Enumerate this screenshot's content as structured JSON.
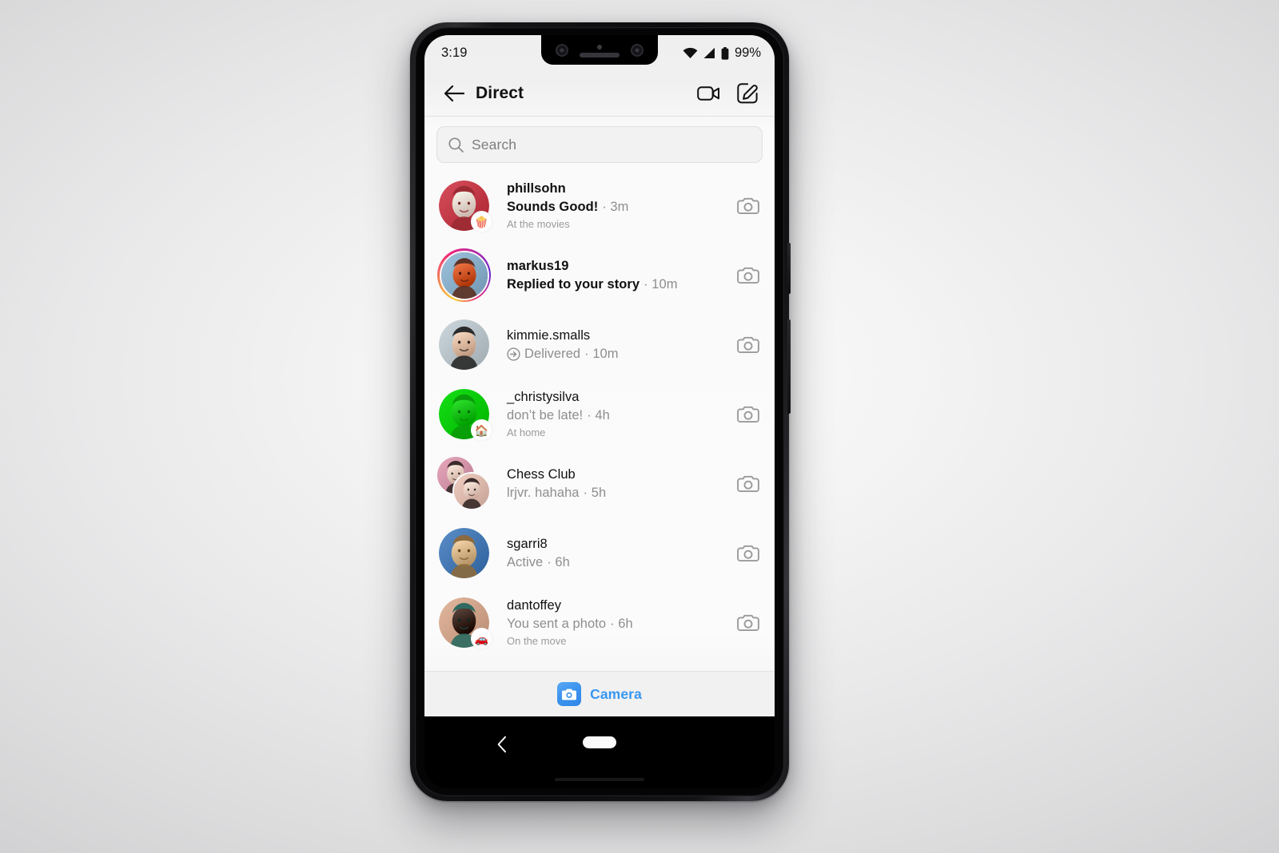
{
  "status_bar": {
    "time": "3:19",
    "battery_percent": "99%",
    "wifi_icon": "wifi-icon",
    "signal_icon": "cellular-signal-icon",
    "battery_icon": "battery-full-icon"
  },
  "header": {
    "back_icon": "back-arrow-icon",
    "title": "Direct",
    "video_call_icon": "video-camera-icon",
    "compose_icon": "compose-edit-icon"
  },
  "search": {
    "placeholder": "Search",
    "value": "",
    "icon": "search-icon"
  },
  "threads": [
    {
      "name": "phillsohn",
      "preview": "Sounds Good!",
      "timestamp": "3m",
      "unread": true,
      "status_note": "At the movies",
      "badge": "popcorn-badge",
      "badge_glyph": "🍿",
      "has_story_ring": false,
      "is_group": false,
      "delivered_icon": false,
      "camera_icon": "camera-icon",
      "avatar_colors": [
        "#d8505d",
        "#f0dcd2",
        "#9c2b33"
      ]
    },
    {
      "name": "markus19",
      "preview": "Replied to your story",
      "timestamp": "10m",
      "unread": true,
      "status_note": "",
      "badge": "",
      "badge_glyph": "",
      "has_story_ring": true,
      "is_group": false,
      "delivered_icon": false,
      "camera_icon": "camera-icon",
      "avatar_colors": [
        "#9dc3de",
        "#d4592a",
        "#5d3224"
      ]
    },
    {
      "name": "kimmie.smalls",
      "preview": "Delivered",
      "timestamp": "10m",
      "unread": false,
      "status_note": "",
      "badge": "",
      "badge_glyph": "",
      "has_story_ring": false,
      "is_group": false,
      "delivered_icon": true,
      "camera_icon": "camera-icon",
      "avatar_colors": [
        "#cdd8de",
        "#e3bda4",
        "#2b2b2b"
      ]
    },
    {
      "name": "_christysilva",
      "preview": "don’t be late!",
      "timestamp": "4h",
      "unread": false,
      "status_note": "At home",
      "badge": "house-badge",
      "badge_glyph": "🏠",
      "has_story_ring": false,
      "is_group": false,
      "delivered_icon": false,
      "camera_icon": "camera-icon",
      "avatar_colors": [
        "#15e015",
        "#0ec40e",
        "#0a9c0a"
      ]
    },
    {
      "name": "Chess Club",
      "preview": "lrjvr. hahaha",
      "timestamp": "5h",
      "unread": false,
      "status_note": "",
      "badge": "",
      "badge_glyph": "",
      "has_story_ring": false,
      "is_group": true,
      "delivered_icon": false,
      "camera_icon": "camera-icon",
      "avatar_colors": [
        "#e8a8bd",
        "#3a2b2a",
        "#f2cfc2"
      ]
    },
    {
      "name": "sgarri8",
      "preview": "Active",
      "timestamp": "6h",
      "unread": false,
      "status_note": "",
      "badge": "",
      "badge_glyph": "",
      "has_story_ring": false,
      "is_group": false,
      "delivered_icon": false,
      "camera_icon": "camera-icon",
      "avatar_colors": [
        "#5b8ec9",
        "#d9b98c",
        "#8a6a3e"
      ]
    },
    {
      "name": "dantoffey",
      "preview": "You sent a photo",
      "timestamp": "6h",
      "unread": false,
      "status_note": "On the move",
      "badge": "car-badge",
      "badge_glyph": "🚗",
      "has_story_ring": false,
      "is_group": false,
      "delivered_icon": false,
      "camera_icon": "camera-icon",
      "avatar_colors": [
        "#e5b9a0",
        "#3d2a22",
        "#2f6b62"
      ]
    }
  ],
  "camera_bar": {
    "label": "Camera",
    "icon": "camera-app-icon",
    "accent_color": "#3897f0"
  },
  "nav_bar": {
    "back_icon": "nav-back-chevron-icon",
    "home_icon": "nav-home-pill-icon"
  },
  "separator": " · "
}
